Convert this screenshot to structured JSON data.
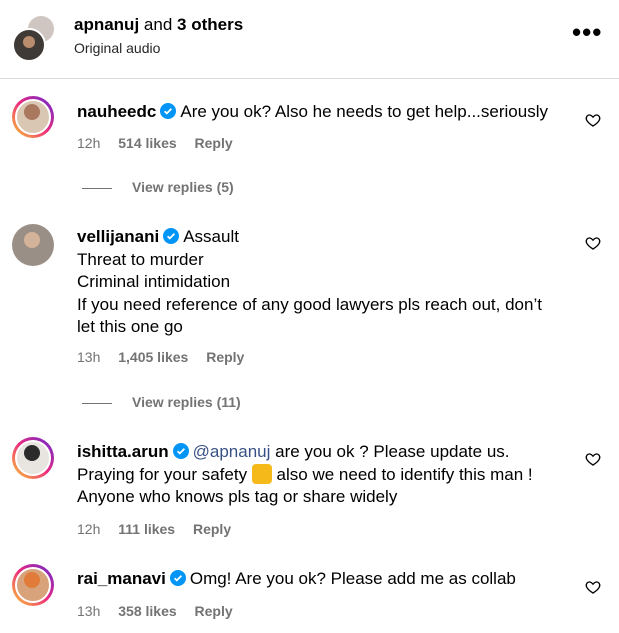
{
  "header": {
    "username": "apnanuj",
    "and_text": "and",
    "others": "3 others",
    "subtitle": "Original audio",
    "more_label": "•••"
  },
  "comments": [
    {
      "username": "nauheedc",
      "lines": [
        "Are you ok? Also he needs to get help...seriously"
      ],
      "time": "12h",
      "likes": "514 likes",
      "reply": "Reply",
      "view_replies": "View replies (5)"
    },
    {
      "username": "vellijanani",
      "lines": [
        "Assault",
        "Threat to murder",
        "Criminal intimidation",
        "If you need reference of any good lawyers pls reach out, don’t",
        "let this one go"
      ],
      "time": "13h",
      "likes": "1,405 likes",
      "reply": "Reply",
      "view_replies": "View replies (11)"
    },
    {
      "username": "ishitta.arun",
      "mention": "@apnanuj",
      "lines": [
        "are you ok ? Please update us.",
        "Praying for your safety",
        "also we need to identify this man !",
        "Anyone who knows pls tag or share widely"
      ],
      "emoji": "praying-hands-emoji",
      "time": "12h",
      "likes": "111 likes",
      "reply": "Reply"
    },
    {
      "username": "rai_manavi",
      "lines": [
        "Omg! Are you ok? Please add me as collab"
      ],
      "time": "13h",
      "likes": "358 likes",
      "reply": "Reply"
    }
  ],
  "colors": {
    "verified": "#0095f6",
    "mention": "#385185",
    "meta": "#737373",
    "ring_start": "#f9ce34",
    "ring_end": "#6228d7"
  }
}
